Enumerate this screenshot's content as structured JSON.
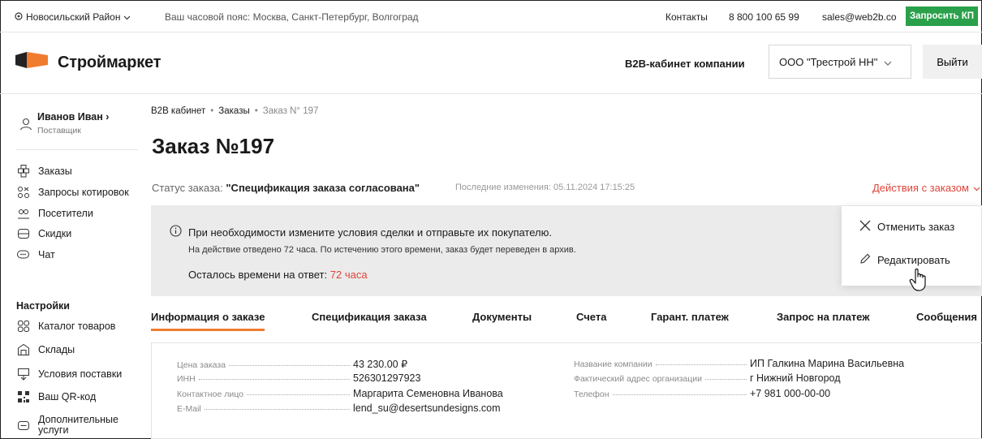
{
  "topbar": {
    "region": "Новосильский Район",
    "timezone": "Ваш часовой пояс: Москва, Санкт-Петербург, Волгоград",
    "contacts": "Контакты",
    "phone": "8 800 100 65 99",
    "email": "sales@web2b.co",
    "request_button": "Запросить КП"
  },
  "header": {
    "logo_text": "Строймаркет",
    "b2b_label": "B2B-кабинет компании",
    "company": "ООО \"Трестрой НН\"",
    "logout": "Выйти"
  },
  "sidebar": {
    "user_name": "Иванов Иван ›",
    "user_role": "Поставщик",
    "items": [
      {
        "label": "Заказы",
        "icon": "orders-icon"
      },
      {
        "label": "Запросы котировок",
        "icon": "quotes-icon"
      },
      {
        "label": "Посетители",
        "icon": "visitors-icon"
      },
      {
        "label": "Скидки",
        "icon": "discounts-icon"
      },
      {
        "label": "Чат",
        "icon": "chat-icon"
      }
    ],
    "settings_heading": "Настройки",
    "settings_items": [
      {
        "label": "Каталог товаров",
        "icon": "catalog-icon"
      },
      {
        "label": "Склады",
        "icon": "warehouse-icon"
      },
      {
        "label": "Условия поставки",
        "icon": "delivery-icon"
      },
      {
        "label": "Ваш QR-код",
        "icon": "qr-icon"
      },
      {
        "label": "Дополнительные услуги",
        "icon": "services-icon"
      }
    ]
  },
  "breadcrumb": [
    "B2B кабинет",
    "Заказы",
    "Заказ N° 197"
  ],
  "order": {
    "title": "Заказ №197",
    "status_label": "Статус заказа:",
    "status_value": "\"Спецификация заказа согласована\"",
    "last_change": "Последние изменения: 05.11.2024 17:15:25",
    "actions": "Действия с заказом"
  },
  "notice": {
    "line1": "При необходимости измените условия сделки и отправьте их покупателю.",
    "line2": "На действие отведено 72 часа. По истечению этого времени, заказ будет переведен в архив.",
    "remaining_label": "Осталось времени на ответ:",
    "remaining_value": "72 часа"
  },
  "dropdown": {
    "cancel": "Отменить заказ",
    "edit": "Редактировать"
  },
  "tabs": [
    "Информация о заказе",
    "Спецификация заказа",
    "Документы",
    "Счета",
    "Гарант. платеж",
    "Запрос на платеж",
    "Сообщения"
  ],
  "info": {
    "left": [
      {
        "label": "Цена заказа",
        "value": "43 230.00 ₽"
      },
      {
        "label": "ИНН",
        "value": "526301297923"
      },
      {
        "label": "Контактное лицо",
        "value": "Маргарита Семеновна Иванова"
      },
      {
        "label": "E-Mail",
        "value": "lend_su@desertsundesigns.com"
      }
    ],
    "right": [
      {
        "label": "Название компании",
        "value": "ИП Галкина Марина Васильевна"
      },
      {
        "label": "Фактический адрес организации",
        "value": "г Нижний Новгород"
      },
      {
        "label": "Телефон",
        "value": "+7 981 000-00-00"
      }
    ]
  },
  "colors": {
    "accent_green": "#2aa04a",
    "accent_red": "#e0443a",
    "accent_orange": "#f07c30"
  }
}
